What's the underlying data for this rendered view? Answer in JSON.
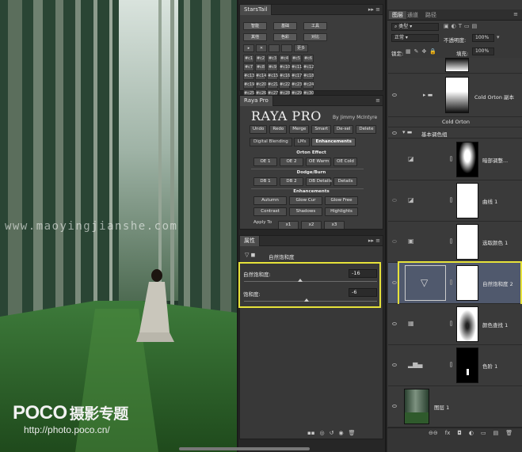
{
  "watermark": {
    "text": "www.maoyingjianshe.com",
    "brand": "POCO",
    "brand_cn": "摄影专题",
    "url": "http://photo.poco.cn/"
  },
  "starstail": {
    "tab": "StarsTail",
    "row1": [
      "智能",
      "基础",
      "工具"
    ],
    "row2": [
      "其他",
      "色彩",
      "对比"
    ],
    "row3": [
      "▸",
      "✕",
      "",
      "",
      "更多"
    ],
    "grid": [
      "#c1",
      "#c2",
      "#c3",
      "#c4",
      "#c5",
      "#c6",
      "#c7",
      "#c8",
      "#c9",
      "#c10",
      "#c11",
      "#c12",
      "#c13",
      "#c14",
      "#c15",
      "#c16",
      "#c17",
      "#c18",
      "#c19",
      "#c20",
      "#c21",
      "#c22",
      "#c23",
      "#c24",
      "#c25",
      "#c26",
      "#c27",
      "#c28",
      "#c29",
      "#c30"
    ]
  },
  "raya": {
    "tab": "Raya Pro",
    "title": "RAYA PRO",
    "by": "By Jimmy McIntyre",
    "row1": [
      "Undo",
      "Redo",
      "Merge",
      "Smart",
      "De-sel",
      "Delete"
    ],
    "tabs": [
      "Digital Blending",
      "LMs",
      "Enhancements"
    ],
    "orton_head": "Orton Effect",
    "orton": [
      "OE 1",
      "OE 2",
      "OE Warm",
      "OE Cold"
    ],
    "dodge_head": "Dodge/Burn",
    "dodge": [
      "DB 1",
      "DB 2",
      "DB Details",
      "Details"
    ],
    "enh_head": "Enhancements",
    "enh1": [
      "Autumn",
      "Glow Cur",
      "Glow Free"
    ],
    "enh2": [
      "Contrast",
      "Shadows",
      "Highlights"
    ],
    "apply": "Apply To",
    "apply_btns": [
      "x1",
      "x2",
      "x3"
    ]
  },
  "properties": {
    "tab": "属性",
    "title": "自然饱和度",
    "vibrance_label": "自然饱和度:",
    "vibrance_value": "-16",
    "vibrance_pos": 0.42,
    "saturation_label": "饱和度:",
    "saturation_value": "-6",
    "saturation_pos": 0.47
  },
  "layers": {
    "tabs": [
      "图层",
      "通道",
      "路径"
    ],
    "filter": "类型",
    "blend": "正常",
    "opacity_label": "不透明度:",
    "opacity_value": "100%",
    "lock_label": "锁定:",
    "fill_label": "填充:",
    "fill_value": "100%",
    "items": [
      {
        "name": "Cold Orton 副本",
        "kind": "group"
      },
      {
        "name": "Cold Orton",
        "kind": "group"
      },
      {
        "name": "基本调色组",
        "kind": "group-open"
      },
      {
        "name": "暗部调整...",
        "kind": "curves"
      },
      {
        "name": "曲线 1",
        "kind": "curves"
      },
      {
        "name": "选取颜色 1",
        "kind": "selective"
      },
      {
        "name": "自然饱和度 2",
        "kind": "vibrance"
      },
      {
        "name": "颜色查找 1",
        "kind": "lookup"
      },
      {
        "name": "色阶 1",
        "kind": "levels"
      },
      {
        "name": "图层 1",
        "kind": "pixel"
      }
    ],
    "footer_icons": [
      "⊖⊖",
      "fx",
      "◘",
      "◐",
      "▭",
      "▤",
      "🗑"
    ]
  },
  "prop_footer": [
    "▪▪",
    "◎",
    "↺",
    "◉",
    "🗑"
  ]
}
